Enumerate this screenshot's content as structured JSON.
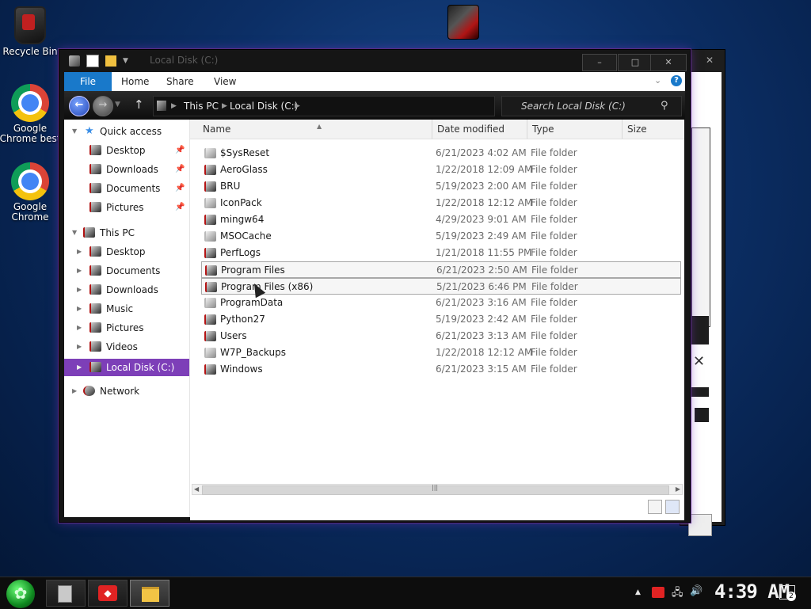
{
  "desktop": {
    "icons": [
      {
        "label": "Recycle Bin"
      },
      {
        "label": "Google Chrome best"
      },
      {
        "label": "Google Chrome"
      }
    ]
  },
  "window": {
    "title": "Local Disk (C:)",
    "controls": {
      "minimize": "–",
      "maximize": "□",
      "close": "✕"
    },
    "ribbon_tabs": [
      "File",
      "Home",
      "Share",
      "View"
    ],
    "ribbon_help": "?",
    "address": [
      "This PC",
      "Local Disk (C:)"
    ],
    "search_placeholder": "Search Local Disk (C:)",
    "nav": {
      "quick_access": "Quick access",
      "quick_items": [
        "Desktop",
        "Downloads",
        "Documents",
        "Pictures"
      ],
      "this_pc": "This PC",
      "pc_items": [
        "Desktop",
        "Documents",
        "Downloads",
        "Music",
        "Pictures",
        "Videos",
        "Local Disk (C:)"
      ],
      "network": "Network"
    },
    "columns": [
      "Name",
      "Date modified",
      "Type",
      "Size"
    ],
    "files": [
      {
        "name": "$SysReset",
        "date": "6/21/2023 4:02 AM",
        "type": "File folder",
        "light": true
      },
      {
        "name": "AeroGlass",
        "date": "1/22/2018 12:09 AM",
        "type": "File folder"
      },
      {
        "name": "BRU",
        "date": "5/19/2023 2:00 AM",
        "type": "File folder"
      },
      {
        "name": "IconPack",
        "date": "1/22/2018 12:12 AM",
        "type": "File folder",
        "light": true
      },
      {
        "name": "mingw64",
        "date": "4/29/2023 9:01 AM",
        "type": "File folder"
      },
      {
        "name": "MSOCache",
        "date": "5/19/2023 2:49 AM",
        "type": "File folder",
        "light": true
      },
      {
        "name": "PerfLogs",
        "date": "1/21/2018 11:55 PM",
        "type": "File folder"
      },
      {
        "name": "Program Files",
        "date": "6/21/2023 2:50 AM",
        "type": "File folder",
        "selected": true
      },
      {
        "name": "Program Files (x86)",
        "date": "5/21/2023 6:46 PM",
        "type": "File folder",
        "selected": true
      },
      {
        "name": "ProgramData",
        "date": "6/21/2023 3:16 AM",
        "type": "File folder",
        "light": true
      },
      {
        "name": "Python27",
        "date": "5/19/2023 2:42 AM",
        "type": "File folder"
      },
      {
        "name": "Users",
        "date": "6/21/2023 3:13 AM",
        "type": "File folder"
      },
      {
        "name": "W7P_Backups",
        "date": "1/22/2018 12:12 AM",
        "type": "File folder",
        "light": true
      },
      {
        "name": "Windows",
        "date": "6/21/2023 3:15 AM",
        "type": "File folder"
      }
    ]
  },
  "taskbar": {
    "clock": "4:39 AM",
    "notifications": "2"
  }
}
